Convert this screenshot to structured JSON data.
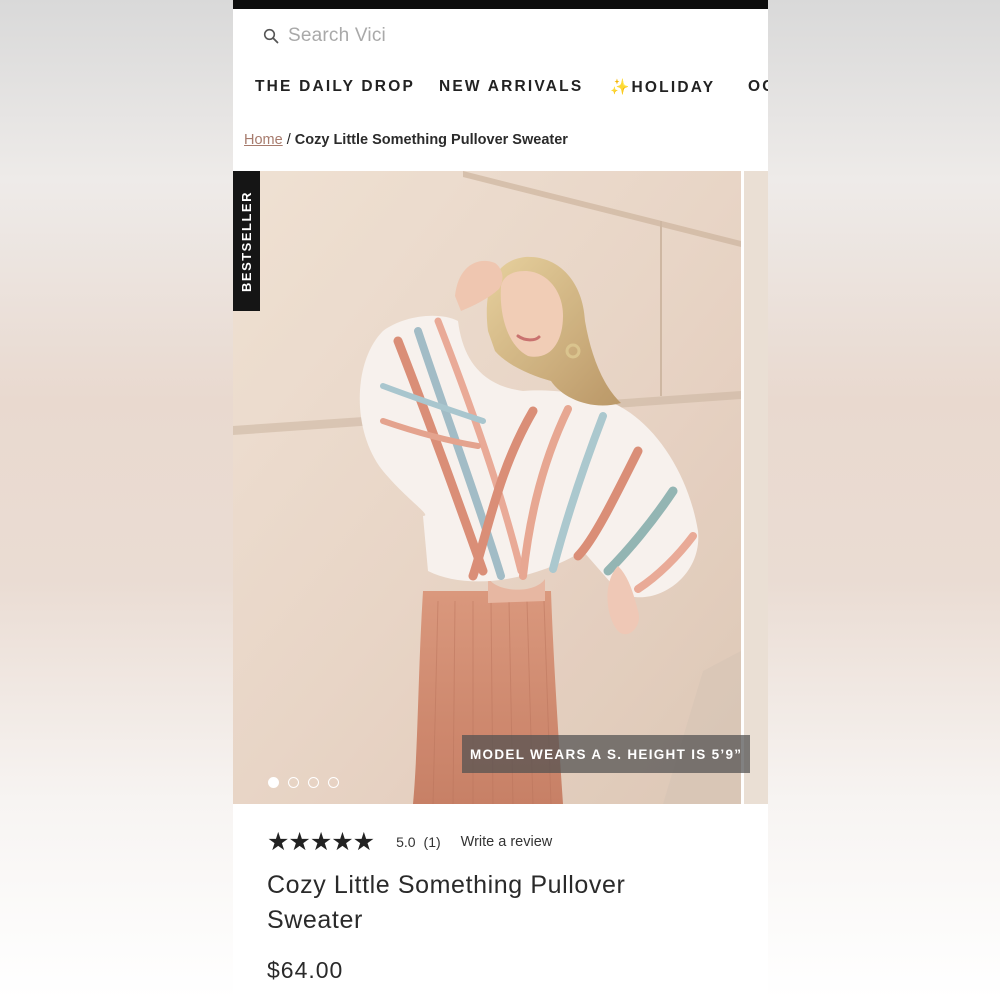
{
  "search": {
    "placeholder": "Search Vici"
  },
  "nav": {
    "items": [
      "THE DAILY DROP",
      "NEW ARRIVALS",
      "✨HOLIDAY",
      "OC"
    ]
  },
  "breadcrumb": {
    "home": "Home",
    "separator": "/",
    "current": "Cozy Little Something Pullover Sweater"
  },
  "gallery": {
    "badge": "BESTSELLER",
    "caption": "MODEL WEARS A S. HEIGHT IS 5’9”",
    "slide_count": 4,
    "active_slide": 1
  },
  "product": {
    "stars": "★★★★★",
    "rating_value": "5.0",
    "review_count": "(1)",
    "write_review": "Write a review",
    "title": "Cozy Little Something Pullover Sweater",
    "price": "$64.00"
  },
  "colors": {
    "accent_link": "#a77b6d",
    "topbar": "#0d0d0d",
    "badge_bg": "#151515"
  },
  "icons": {
    "search": "search-icon"
  }
}
